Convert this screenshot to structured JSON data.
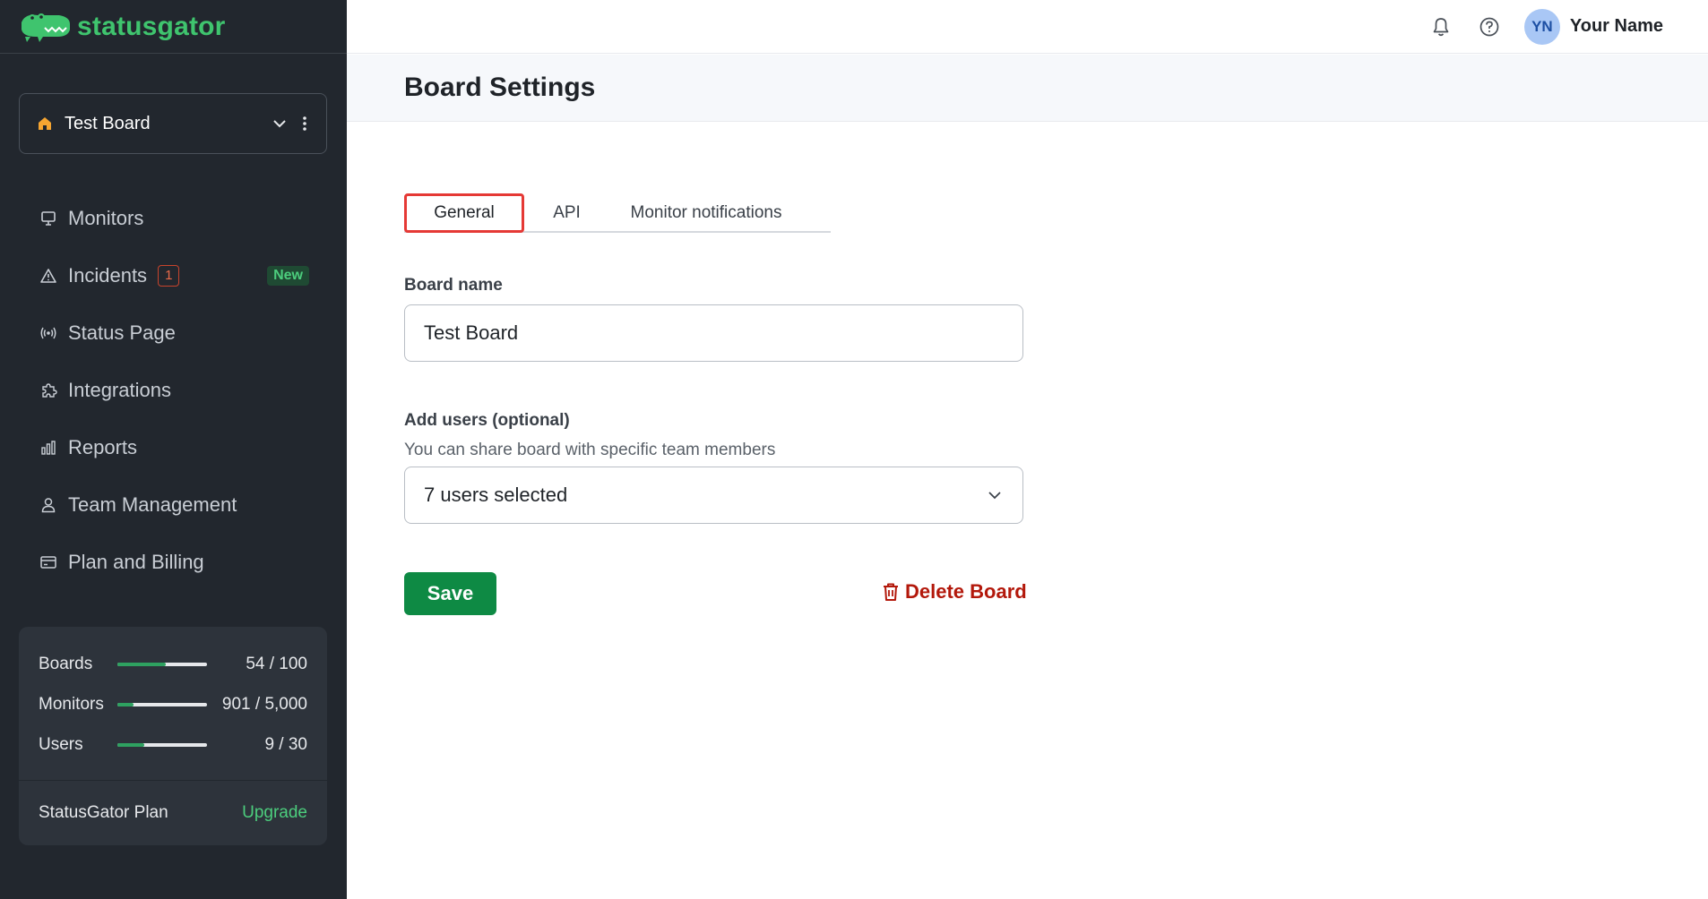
{
  "brand": {
    "name": "statusgator",
    "color": "#3fc46e"
  },
  "sidebar": {
    "board_selector": {
      "name": "Test Board"
    },
    "nav": [
      {
        "label": "Monitors",
        "icon": "monitor-icon"
      },
      {
        "label": "Incidents",
        "icon": "warning-icon",
        "count": "1",
        "tag": "New"
      },
      {
        "label": "Status Page",
        "icon": "broadcast-icon"
      },
      {
        "label": "Integrations",
        "icon": "puzzle-icon"
      },
      {
        "label": "Reports",
        "icon": "bar-chart-icon"
      },
      {
        "label": "Team Management",
        "icon": "user-icon"
      },
      {
        "label": "Plan and Billing",
        "icon": "credit-card-icon"
      }
    ],
    "usage": [
      {
        "label": "Boards",
        "value": "54 / 100",
        "fraction": 0.54
      },
      {
        "label": "Monitors",
        "value": "901 / 5,000",
        "fraction": 0.18
      },
      {
        "label": "Users",
        "value": "9 / 30",
        "fraction": 0.3
      }
    ],
    "plan": {
      "name": "StatusGator Plan",
      "upgrade_label": "Upgrade"
    }
  },
  "topbar": {
    "user": {
      "initials": "YN",
      "name": "Your Name"
    },
    "icons": [
      "bell-icon",
      "help-icon"
    ]
  },
  "page": {
    "title": "Board Settings",
    "tabs": [
      {
        "label": "General",
        "active": true
      },
      {
        "label": "API",
        "active": false
      },
      {
        "label": "Monitor notifications",
        "active": false
      }
    ],
    "form": {
      "board_name_label": "Board name",
      "board_name_value": "Test Board",
      "users_label": "Add users (optional)",
      "users_help": "You can share board with specific team members",
      "users_value": "7 users selected",
      "save_label": "Save",
      "delete_label": "Delete Board"
    }
  },
  "colors": {
    "sidebar_bg": "#22272e",
    "accent_green": "#0e8a44",
    "danger": "#b3180b",
    "highlight": "#e53935"
  }
}
